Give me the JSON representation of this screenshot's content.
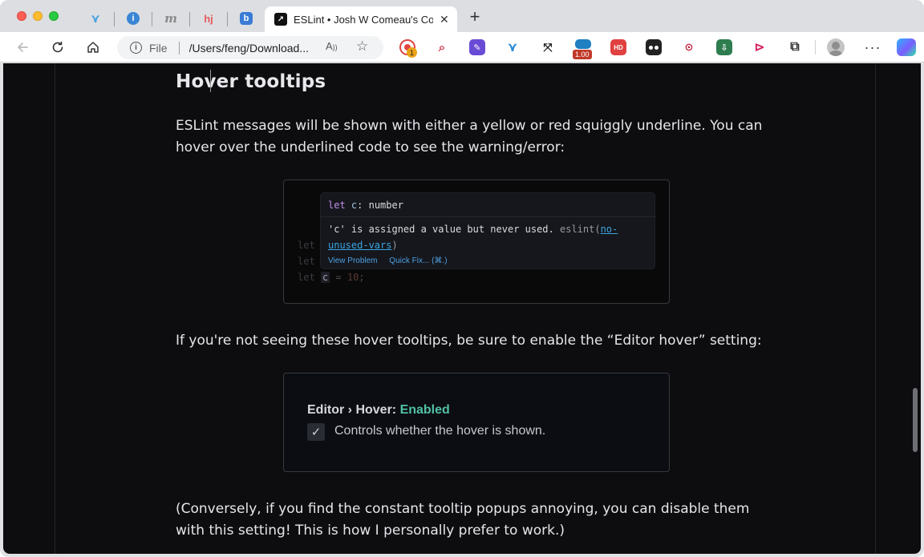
{
  "browser": {
    "pinned_tabs": [
      {
        "icon": "vue-icon",
        "glyph": "⋎",
        "color": "#4aa3e0"
      },
      {
        "icon": "info-tab-icon",
        "glyph": "i",
        "color": "#3a86d4"
      },
      {
        "icon": "m-tab-icon",
        "glyph": "m",
        "color": "#8a8a8a"
      },
      {
        "icon": "hj-tab-icon",
        "glyph": "hj",
        "color": "#e85a5a"
      },
      {
        "icon": "b-tab-icon",
        "glyph": "b",
        "color": "#3a7bd5"
      }
    ],
    "active_tab": {
      "title": "ESLint • Josh W Comeau's Cou",
      "favicon": "↗",
      "close": "✕"
    },
    "new_tab": "+",
    "address": {
      "scheme": "File",
      "url": "/Users/feng/Download..."
    },
    "extension_badges": {
      "first": "1",
      "speed": "1.00"
    }
  },
  "article": {
    "heading": "Hover tooltips",
    "para1": "ESLint messages will be shown with either a yellow or red squiggly underline. You can hover over the underlined code to see the warning/error:",
    "code_lines": [
      {
        "kw": "let",
        "rest": ""
      },
      {
        "kw": "let",
        "rest": ""
      },
      {
        "kw": "let",
        "var": "c",
        "rest": " = ",
        "num": "10",
        "end": ";"
      }
    ],
    "tooltip": {
      "sig_kw": "let",
      "sig_id": "c",
      "sig_rest": ": number",
      "msg_main": "'c' is assigned a value but never used.",
      "msg_src": "eslint(",
      "msg_link": "no-unused-vars",
      "msg_end": ")",
      "action_view": "View Problem",
      "action_fix": "Quick Fix... (⌘.)"
    },
    "para2": "If you're not seeing these hover tooltips, be sure to enable the “Editor hover” setting:",
    "setting": {
      "path": "Editor › Hover: ",
      "value": "Enabled",
      "check": "✓",
      "description": "Controls whether the hover is shown."
    },
    "para3": "(Conversely, if you find the constant tooltip popups annoying, you can disable them with this setting! This is how I personally prefer to work.)"
  }
}
